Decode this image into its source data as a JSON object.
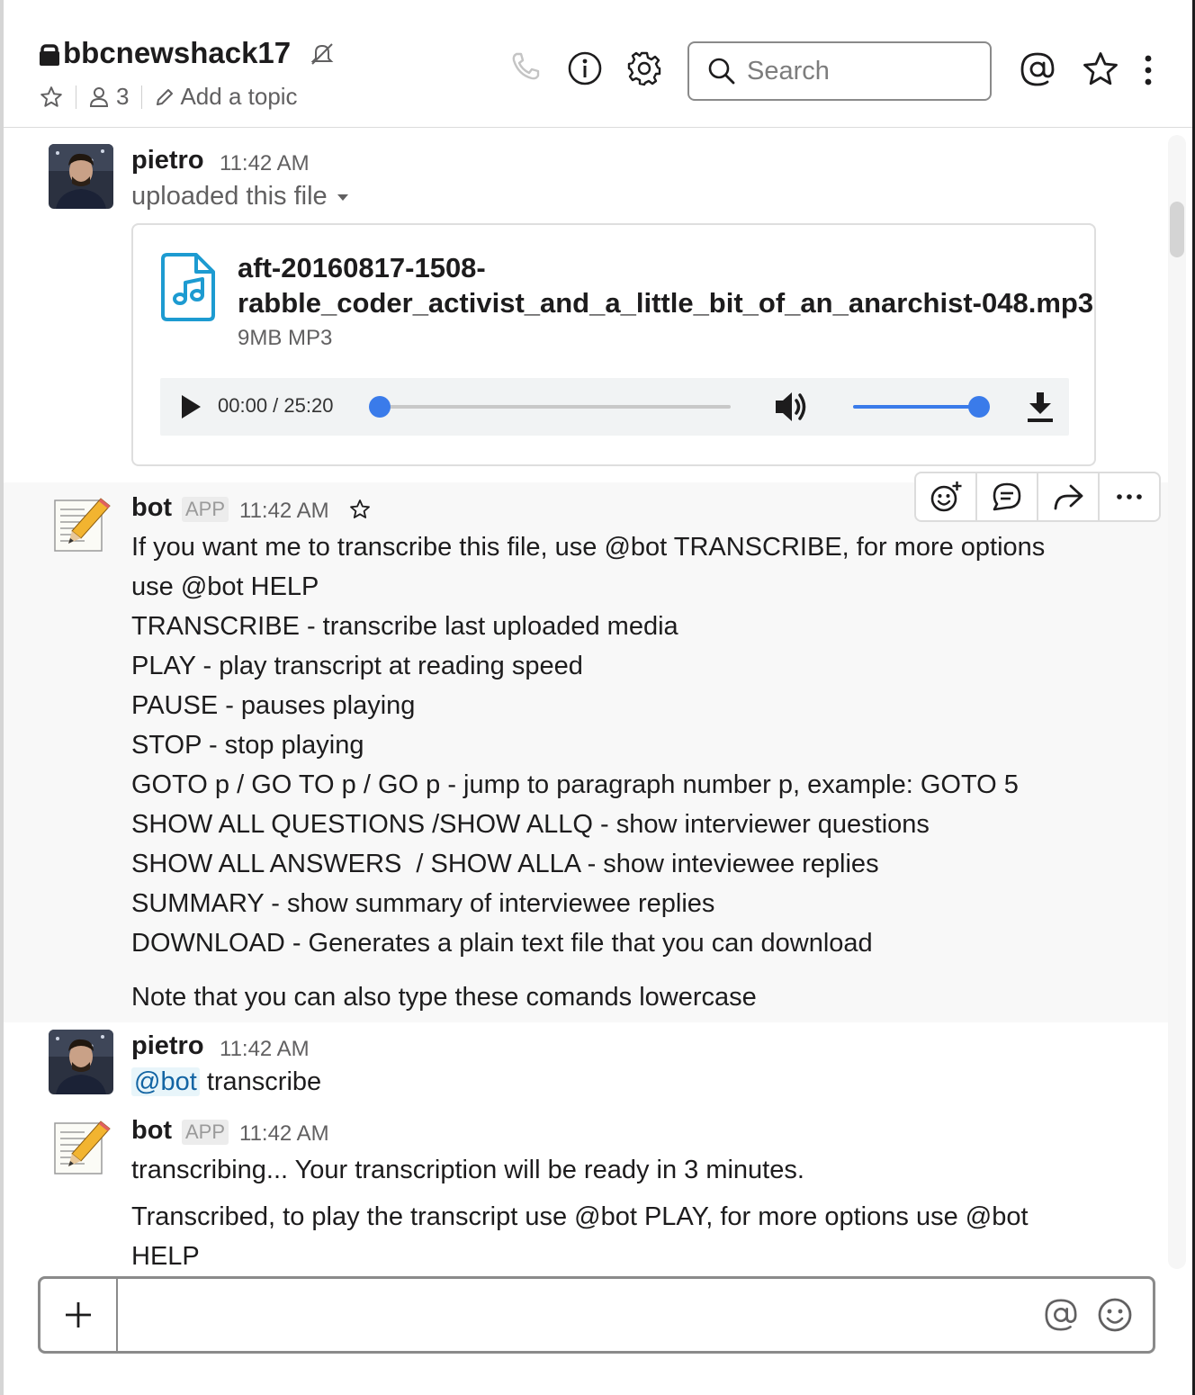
{
  "header": {
    "channel_name": "bbcnewshack17",
    "member_count": "3",
    "add_topic": "Add a topic",
    "search_placeholder": "Search"
  },
  "messages": [
    {
      "author": "pietro",
      "time": "11:42 AM",
      "subtitle": "uploaded this file",
      "file": {
        "name_line1": "aft-20160817-1508-",
        "name_line2": "rabble_coder_activist_and_a_little_bit_of_an_anarchist-048.mp3",
        "meta": "9MB MP3",
        "player_time": "00:00 / 25:20",
        "progress": 0,
        "volume": 1.0
      }
    },
    {
      "author": "bot",
      "badge": "APP",
      "time": "11:42 AM",
      "lines": [
        "If you want me to transcribe this file, use @bot TRANSCRIBE, for more options",
        "use @bot HELP",
        "TRANSCRIBE - transcribe last uploaded media",
        "PLAY - play transcript at reading speed",
        "PAUSE - pauses playing",
        "STOP - stop playing",
        "GOTO p / GO TO p / GO p - jump to paragraph number p, example: GOTO 5",
        "SHOW ALL QUESTIONS /SHOW ALLQ - show interviewer questions",
        "SHOW ALL ANSWERS  / SHOW ALLA - show inteviewee replies",
        "SUMMARY - show summary of interviewee replies",
        "DOWNLOAD - Generates a plain text file that you can download"
      ],
      "note": "Note that you can also type these comands lowercase"
    },
    {
      "author": "pietro",
      "time": "11:42 AM",
      "mention": "@bot",
      "text": "transcribe"
    },
    {
      "author": "bot",
      "badge": "APP",
      "time": "11:42 AM",
      "line1": "transcribing... Your transcription will be ready in 3 minutes.",
      "line2a": "Transcribed, to play the transcript use @bot PLAY, for more options use @bot",
      "line2b": "HELP"
    }
  ],
  "colors": {
    "accent": "#1264a3",
    "file_icon": "#1d9bd1",
    "player_blue": "#3a7bea"
  }
}
